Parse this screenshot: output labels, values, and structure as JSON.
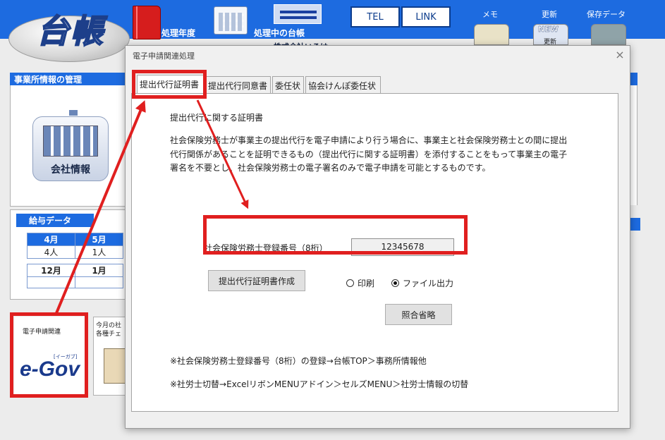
{
  "header": {
    "logo_text": "台帳",
    "processing_year_label": "処理年度",
    "current_ledger_label": "処理中の台帳",
    "current_ledger_value": "株式会社いろは",
    "tel_button": "TEL",
    "link_button": "LINK",
    "memo_label": "メモ",
    "update_label": "更新",
    "update_badge": "NEW",
    "update_sub": "更新",
    "saved_data_label": "保存データ"
  },
  "sidebar": {
    "office_panel_title": "事業所情報の管理",
    "company_info_label": "会社情報",
    "payroll_title": "給与データ",
    "payroll_rows": [
      [
        "4月",
        "5月"
      ],
      [
        "4人",
        "1人"
      ],
      [
        "12月",
        "1月"
      ],
      [
        "",
        ""
      ]
    ],
    "egov_title": "電子申請関連",
    "egov_logo": "e-Gov",
    "egov_sub": "[イーガブ]",
    "monthly_title_1": "今月の社",
    "monthly_title_2": "各種チェ"
  },
  "dialog": {
    "title": "電子申請関連処理",
    "close_icon": "×",
    "tabs": [
      {
        "label": "提出代行証明書",
        "active": true
      },
      {
        "label": "提出代行同意書",
        "active": false
      },
      {
        "label": "委任状",
        "active": false
      },
      {
        "label": "協会けんぽ委任状",
        "active": false
      }
    ],
    "heading": "提出代行に関する証明書",
    "description": [
      "社会保険労務士が事業主の提出代行を電子申請により行う場合に、事業主と社会保険労務士との間に提出",
      "代行関係があることを証明できるもの（提出代行に関する証明書）を添付することをもって事業主の電子",
      "署名を不要とし、社会保険労務士の電子署名のみで電子申請を可能とするものです。"
    ],
    "reg_number_label": "社会保険労務士登録番号（8桁）",
    "reg_number_value": "12345678",
    "create_button": "提出代行証明書作成",
    "output_options": [
      {
        "label": "印刷",
        "selected": false
      },
      {
        "label": "ファイル出力",
        "selected": true
      }
    ],
    "seal_button": "照合省略",
    "notes": [
      "※社会保険労務士登録番号（8桁）の登録→台帳TOP＞事務所情報他",
      "※社労士切替→ExcelリボンMENUアドイン＞セルズMENU＞社労士情報の切替"
    ]
  },
  "colors": {
    "header_blue": "#1d6be0",
    "annotation_red": "#e01f1f"
  }
}
